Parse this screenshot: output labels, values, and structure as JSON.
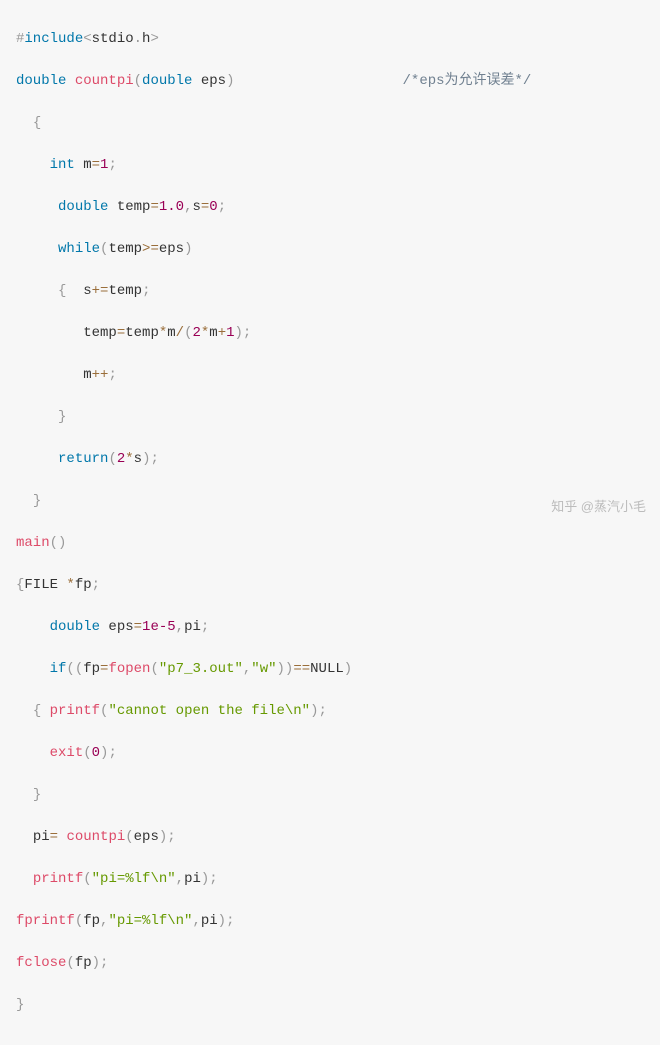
{
  "code": {
    "l1": {
      "hash": "#",
      "inc": "include",
      "lt": "<",
      "hdr": "stdio",
      "dot": ".",
      "h": "h",
      "gt": ">"
    },
    "l2": {
      "t": "double",
      "sp": " ",
      "fn": "countpi",
      "lp": "(",
      "pt": "double",
      "ps": " eps",
      "rp": ")",
      "pad": "                    ",
      "cm": "/*eps为允许误差*/"
    },
    "l3": {
      "ind": "  ",
      "lb": "{"
    },
    "l4": {
      "ind": "    ",
      "t": "int",
      "sp": " m",
      "eq": "=",
      "v": "1",
      "sc": ";"
    },
    "l5": {
      "ind": "     ",
      "t": "double",
      "sp": " temp",
      "eq": "=",
      "v1": "1.0",
      "c1": ",",
      "s": "s",
      "eq2": "=",
      "v2": "0",
      "sc": ";"
    },
    "l6": {
      "ind": "     ",
      "kw": "while",
      "lp": "(",
      "a": "temp",
      "op": ">=",
      "b": "eps",
      "rp": ")"
    },
    "l7": {
      "ind": "     ",
      "lb": "{",
      "sp": "  s",
      "op": "+=",
      "b": "temp",
      "sc": ";"
    },
    "l8": {
      "ind": "        ",
      "a": "temp",
      "eq": "=",
      "b": "temp",
      "op1": "*",
      "c": "m",
      "op2": "/",
      "lp": "(",
      "two": "2",
      "op3": "*",
      "d": "m",
      "op4": "+",
      "one": "1",
      "rp": ")",
      "sc": ";"
    },
    "l9": {
      "ind": "        ",
      "a": "m",
      "op": "++",
      "sc": ";"
    },
    "l10": {
      "ind": "     ",
      "rb": "}"
    },
    "l11": {
      "ind": "     ",
      "kw": "return",
      "lp": "(",
      "two": "2",
      "op": "*",
      "s": "s",
      "rp": ")",
      "sc": ";"
    },
    "l12": {
      "ind": "  ",
      "rb": "}"
    },
    "l13": {
      "fn": "main",
      "lp": "(",
      "rp": ")"
    },
    "l14": {
      "lb": "{",
      "t": "FILE ",
      "op": "*",
      "v": "fp",
      "sc": ";"
    },
    "l15": {
      "ind": "    ",
      "t": "double",
      "sp": " eps",
      "eq": "=",
      "v": "1e-5",
      "c": ",",
      "p": "pi",
      "sc": ";"
    },
    "l16": {
      "ind": "    ",
      "kw": "if",
      "lp1": "(",
      "lp2": "(",
      "a": "fp",
      "eq": "=",
      "fn": "fopen",
      "lp3": "(",
      "s1": "\"p7_3.out\"",
      "c": ",",
      "s2": "\"w\"",
      "rp3": ")",
      "rp2": ")",
      "op": "==",
      "nl": "NULL",
      "rp1": ")"
    },
    "l17": {
      "ind": "  ",
      "lb": "{",
      "sp": " ",
      "fn": "printf",
      "lp": "(",
      "s": "\"cannot open the file\\n\"",
      "rp": ")",
      "sc": ";"
    },
    "l18": {
      "ind": "    ",
      "fn": "exit",
      "lp": "(",
      "v": "0",
      "rp": ")",
      "sc": ";"
    },
    "l19": {
      "ind": "  ",
      "rb": "}"
    },
    "l20": {
      "ind": "  ",
      "a": "pi",
      "eq": "=",
      "sp": " ",
      "fn": "countpi",
      "lp": "(",
      "b": "eps",
      "rp": ")",
      "sc": ";"
    },
    "l21": {
      "ind": "  ",
      "fn": "printf",
      "lp": "(",
      "s": "\"pi=%lf\\n\"",
      "c": ",",
      "a": "pi",
      "rp": ")",
      "sc": ";"
    },
    "l22": {
      "fn": "fprintf",
      "lp": "(",
      "a": "fp",
      "c1": ",",
      "s": "\"pi=%lf\\n\"",
      "c2": ",",
      "b": "pi",
      "rp": ")",
      "sc": ";"
    },
    "l23": {
      "fn": "fclose",
      "lp": "(",
      "a": "fp",
      "rp": ")",
      "sc": ";"
    },
    "l24": {
      "rb": "}"
    }
  },
  "watermark": "知乎 @蒸汽小毛"
}
